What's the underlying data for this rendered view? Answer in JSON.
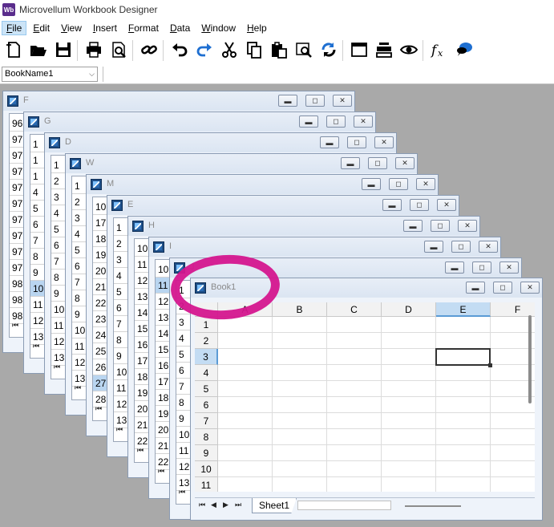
{
  "app": {
    "title": "Microvellum Workbook Designer",
    "logo_text": "Wb"
  },
  "menu": [
    {
      "label": "File",
      "mnemonic": "F",
      "rest": "ile"
    },
    {
      "label": "Edit",
      "mnemonic": "E",
      "rest": "dit"
    },
    {
      "label": "View",
      "mnemonic": "V",
      "rest": "iew"
    },
    {
      "label": "Insert",
      "mnemonic": "I",
      "rest": "nsert"
    },
    {
      "label": "Format",
      "mnemonic": "F",
      "rest": "ormat"
    },
    {
      "label": "Data",
      "mnemonic": "D",
      "rest": "ata"
    },
    {
      "label": "Window",
      "mnemonic": "W",
      "rest": "indow"
    },
    {
      "label": "Help",
      "mnemonic": "H",
      "rest": "elp"
    }
  ],
  "toolbar": [
    "new-file-icon",
    "open-folder-icon",
    "save-icon",
    "|",
    "print-icon",
    "print-preview-icon",
    "|",
    "link-icon",
    "|",
    "undo-icon",
    "redo-icon",
    "cut-icon",
    "copy-icon",
    "paste-icon",
    "find-icon",
    "refresh-icon",
    "|",
    "window-icon",
    "printer-stack-icon",
    "eye-icon",
    "|",
    "function-icon",
    "comment-icon"
  ],
  "namebox": {
    "value": "BookName1"
  },
  "background_windows": [
    {
      "title": "F",
      "rows": [
        "96",
        "97",
        "97",
        "97",
        "97",
        "97",
        "97",
        "97",
        "97",
        "97",
        "98",
        "98",
        "98"
      ],
      "selected_row": -1
    },
    {
      "title": "G",
      "rows": [
        "1",
        "1",
        "1",
        "4",
        "5",
        "6",
        "7",
        "8",
        "9",
        "10",
        "11",
        "12",
        "13"
      ],
      "selected_row": 9
    },
    {
      "title": "D",
      "rows": [
        "1",
        "2",
        "3",
        "4",
        "5",
        "6",
        "7",
        "8",
        "9",
        "10",
        "11",
        "12",
        "13"
      ],
      "selected_row": -1
    },
    {
      "title": "W",
      "rows": [
        "1",
        "2",
        "3",
        "4",
        "5",
        "6",
        "7",
        "8",
        "9",
        "10",
        "11",
        "12",
        "13"
      ],
      "selected_row": -1
    },
    {
      "title": "M",
      "rows": [
        "10",
        "17",
        "18",
        "19",
        "20",
        "21",
        "22",
        "23",
        "24",
        "25",
        "26",
        "27",
        "28"
      ],
      "selected_row": 11
    },
    {
      "title": "E",
      "rows": [
        "1",
        "2",
        "3",
        "4",
        "5",
        "6",
        "7",
        "8",
        "9",
        "10",
        "11",
        "12",
        "13"
      ],
      "selected_row": -1
    },
    {
      "title": "H",
      "rows": [
        "10",
        "11",
        "12",
        "13",
        "14",
        "15",
        "16",
        "17",
        "18",
        "19",
        "20",
        "21",
        "22"
      ],
      "selected_row": -1
    },
    {
      "title": "I",
      "rows": [
        "10",
        "11",
        "12",
        "13",
        "14",
        "15",
        "16",
        "17",
        "18",
        "19",
        "20",
        "21",
        "22"
      ],
      "selected_row": 1
    },
    {
      "title": "J",
      "rows": [
        "1",
        "2",
        "3",
        "4",
        "5",
        "6",
        "7",
        "8",
        "9",
        "10",
        "11",
        "12",
        "13"
      ],
      "selected_row": -1
    }
  ],
  "book": {
    "title": "Book1",
    "columns": [
      "A",
      "B",
      "C",
      "D",
      "E",
      "F"
    ],
    "selected_column": "E",
    "rows": [
      "1",
      "2",
      "3",
      "4",
      "5",
      "6",
      "7",
      "8",
      "9",
      "10",
      "11"
    ],
    "selected_row": "3",
    "active_cell": "E3",
    "sheet_tab": "Sheet1"
  },
  "colors": {
    "workspace": "#a9a9a9",
    "annotation": "#d4168e",
    "selection": "#c3dcf3"
  }
}
